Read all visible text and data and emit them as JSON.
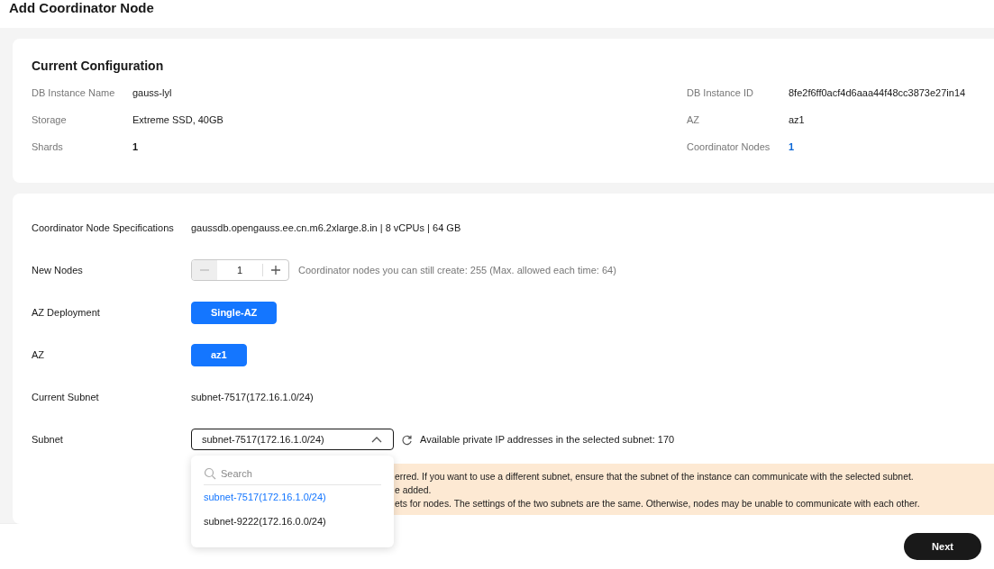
{
  "title": "Add Coordinator Node",
  "current_configuration": {
    "heading": "Current Configuration",
    "fields": [
      {
        "label": "DB Instance Name",
        "value": "gauss-lyl",
        "kind": "text"
      },
      {
        "label": "DB Instance ID",
        "value": "8fe2f6ff0acf4d6aaa44f48cc3873e27in14",
        "kind": "text"
      },
      {
        "label": "Storage",
        "value": "Extreme SSD, 40GB",
        "kind": "text"
      },
      {
        "label": "AZ",
        "value": "az1",
        "kind": "text"
      },
      {
        "label": "Shards",
        "value": "1",
        "kind": "count"
      },
      {
        "label": "Coordinator Nodes",
        "value": "1",
        "kind": "link"
      }
    ]
  },
  "form": {
    "specifications": {
      "label": "Coordinator Node Specifications",
      "value": "gaussdb.opengauss.ee.cn.m6.2xlarge.8.in | 8 vCPUs | 64 GB"
    },
    "new_nodes": {
      "label": "New Nodes",
      "value": "1",
      "minus_disabled": true,
      "hint": "Coordinator nodes you can still create: 255 (Max. allowed each time: 64)"
    },
    "az_deployment": {
      "label": "AZ Deployment",
      "options": [
        {
          "label": "Single-AZ",
          "selected": true
        }
      ]
    },
    "az": {
      "label": "AZ",
      "options": [
        {
          "label": "az1",
          "selected": true
        }
      ]
    },
    "current_subnet": {
      "label": "Current Subnet",
      "value": "subnet-7517(172.16.1.0/24)"
    },
    "subnet": {
      "label": "Subnet",
      "value": "subnet-7517(172.16.1.0/24)",
      "expanded": true,
      "hint": "Available private IP addresses in the selected subnet: 170",
      "search_placeholder": "Search",
      "options": [
        {
          "label": "subnet-7517(172.16.1.0/24)",
          "selected": true
        },
        {
          "label": "subnet-9222(172.16.0.0/24)",
          "selected": false
        }
      ]
    },
    "notice_lines": [
      "erred. If you want to use a different subnet, ensure that the subnet of the instance can communicate with the selected subnet.",
      "e added.",
      "ets for nodes. The settings of the two subnets are the same. Otherwise, nodes may be unable to communicate with each other."
    ]
  },
  "footer": {
    "next_button": "Next"
  }
}
